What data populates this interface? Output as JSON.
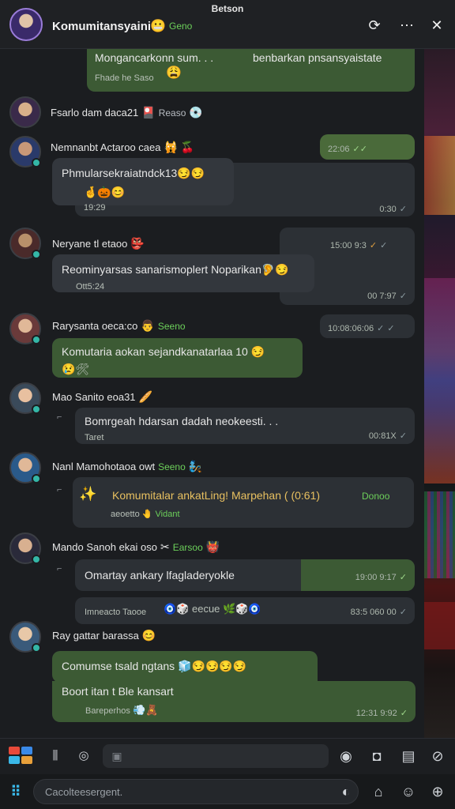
{
  "status_bar": {
    "center_text": "Betson"
  },
  "header": {
    "title": "Komumitansyaini",
    "title_emoji": "😬",
    "badge": "Geno",
    "icons": [
      "refresh-icon",
      "more-icon",
      "close-icon"
    ]
  },
  "colors": {
    "accent": "#6ccf5a",
    "bubble_green": "#3c5a34",
    "bubble_dark": "#2c3035",
    "check": "#9fd88a"
  },
  "messages": [
    {
      "bubble_text": "Mongancarkonn sum. . .",
      "bubble_text_2": "benbarkan pnsansyaistate",
      "sub": "Fhade he Saso",
      "sub_emoji": "😩"
    },
    {
      "sender": "Fsarlo dam daca21",
      "emoji": "🎴",
      "tag": "Reaso",
      "emoji2": "💿"
    },
    {
      "sender": "Nemnanbt Actaroo caea",
      "emoji": "🙀",
      "emoji2": "🍒",
      "time_right": "22:06",
      "bubble_text": "Phmularsekraiatndck13",
      "bubble_emojis": "😏😏",
      "sub": "🤞🎃😊",
      "sub2": "19:29",
      "time": "0:30"
    },
    {
      "sender": "Neryane tl etaoo",
      "emoji": "👺",
      "time_right": "15:00 9:3",
      "bubble_text": "Reominyarsas sanarismoplert Noparikan",
      "bubble_emojis": "🦻😏",
      "sub": "Ott5:24",
      "time": "00 7:97"
    },
    {
      "sender": "Rarysanta oeca:co",
      "emoji": "👨",
      "tag": "Seeno",
      "time_right": "10:08:06:06",
      "bubble_text": "Komutaria aokan sejandkanatarlaa 10",
      "bubble_emojis": "😏",
      "sub": "😢🛠"
    },
    {
      "sender": "Mao Sanito eoa31",
      "emoji": "🥖",
      "bubble_text": "Bomrgeah hdarsan dadah neokeesti. . .",
      "sub": "Taret",
      "time": "00:81X"
    },
    {
      "sender": "Nanl Mamohotaoa owt",
      "tag": "Seeno",
      "emoji": "🧞",
      "bubble_text": "Komumitalar ankatLing! Marpehan ( (0:61)",
      "tag2": "Donoo",
      "lead_emoji": "✨",
      "sub": "aeoetto",
      "sub_emoji": "🤚",
      "sub_tag": "Vidant"
    },
    {
      "sender": "Mando Sanoh ekai oso",
      "emoji": "✂",
      "tag": "Earsoo",
      "emoji2": "👹",
      "bubble_text": "Omartay ankary lfagladeryokle",
      "time": "19:00 9:17",
      "sub_line": "Imneacto Taooe",
      "sub_emojis": "🧿🎲 eecue 🌿🎲🧿",
      "sub_time": "83:5 060 00"
    },
    {
      "sender": "Ray gattar barassa",
      "emoji": "😊",
      "bubble_text": "Comumse tsald ngtans",
      "bubble_emojis": "🧊😏😏😏😏",
      "bubble_text_2": "Boort itan t Ble kansart",
      "sub": "Bareperhos",
      "sub_emojis": "💨🧸",
      "time": "12:31 9:92"
    }
  ],
  "toolbar": {
    "icons": [
      "apps-logo-icon",
      "layout-icon",
      "camera-ring-icon",
      "image-icon",
      "record-icon",
      "camera-icon",
      "briefcase-icon",
      "alert-icon"
    ]
  },
  "composer": {
    "placeholder": "Cacolteesergent.",
    "icons": [
      "hash-icon",
      "emoji-icon",
      "attach-icon",
      "sticker-icon",
      "globe-icon"
    ]
  }
}
